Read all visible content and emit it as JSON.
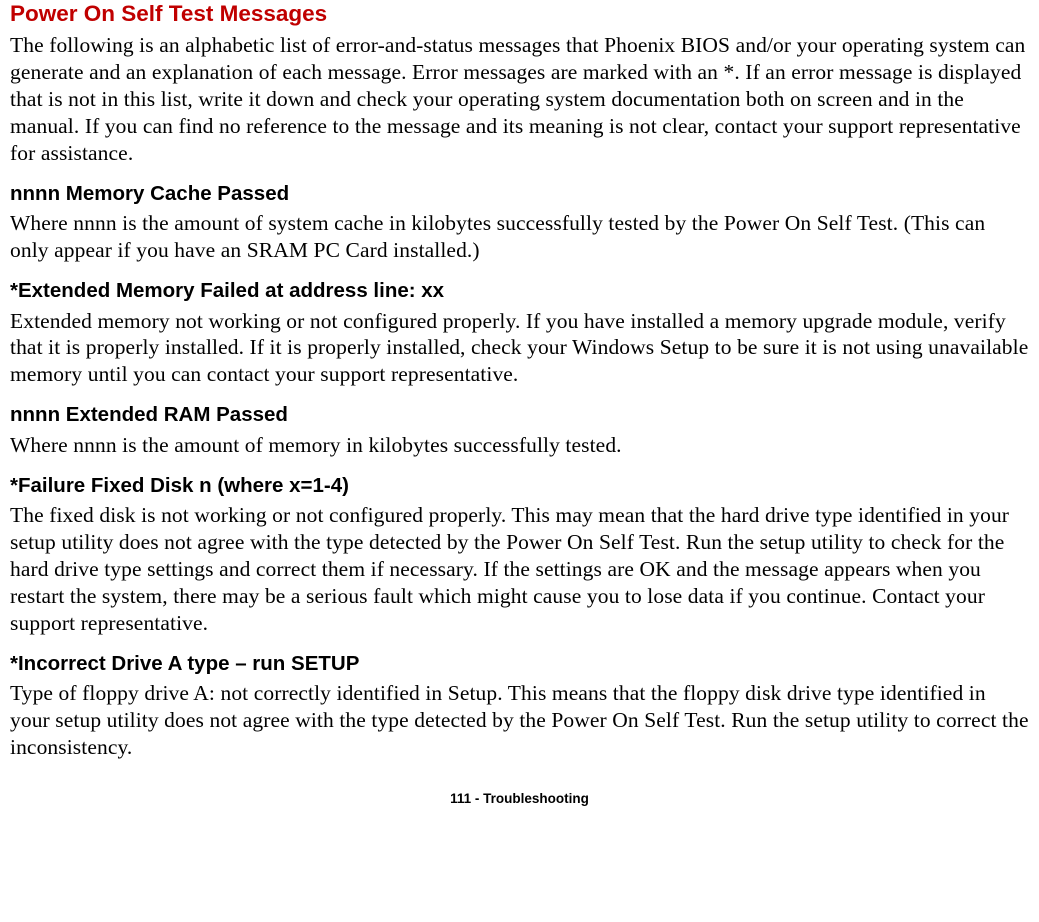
{
  "heading": "Power On Self Test Messages",
  "intro": "The following is an alphabetic list of error-and-status messages that Phoenix BIOS and/or your operating system can generate and an explanation of each message. Error messages are marked with an *. If an error message is displayed that is not in this list, write it down and check your operating system documentation both on screen and in the manual. If you can find no reference to the message and its meaning is not clear, contact your support representative for assistance.",
  "sections": [
    {
      "title": "nnnn Memory Cache Passed",
      "body": "Where nnnn is the amount of system cache in kilobytes successfully tested by the Power On Self Test. (This can only appear if you have an SRAM PC Card installed.)"
    },
    {
      "title": "*Extended Memory Failed at address line: xx",
      "body": "Extended memory not working or not configured properly. If you have installed a memory upgrade module, verify that it is properly installed. If it is properly installed, check your Windows Setup to be sure it is not using unavailable memory until you can contact your support representative."
    },
    {
      "title": "nnnn Extended RAM Passed",
      "body": "Where nnnn is the amount of memory in kilobytes successfully tested."
    },
    {
      "title": "*Failure Fixed Disk n (where x=1-4)",
      "body": "The fixed disk is not working or not configured properly. This may mean that the hard drive type identified in your setup utility does not agree with the type detected by the Power On Self Test. Run the setup utility to check for the hard drive type settings and correct them if necessary. If the settings are OK and the message appears when you restart the system, there may be a serious fault which might cause you to lose data if you continue. Contact your support representative."
    },
    {
      "title": "*Incorrect Drive A type – run SETUP",
      "body": "Type of floppy drive A: not correctly identified in Setup. This means that the floppy disk drive type identified in your setup utility does not agree with the type detected by the Power On Self Test. Run the setup utility to correct the inconsistency."
    }
  ],
  "footer": "111 - Troubleshooting"
}
